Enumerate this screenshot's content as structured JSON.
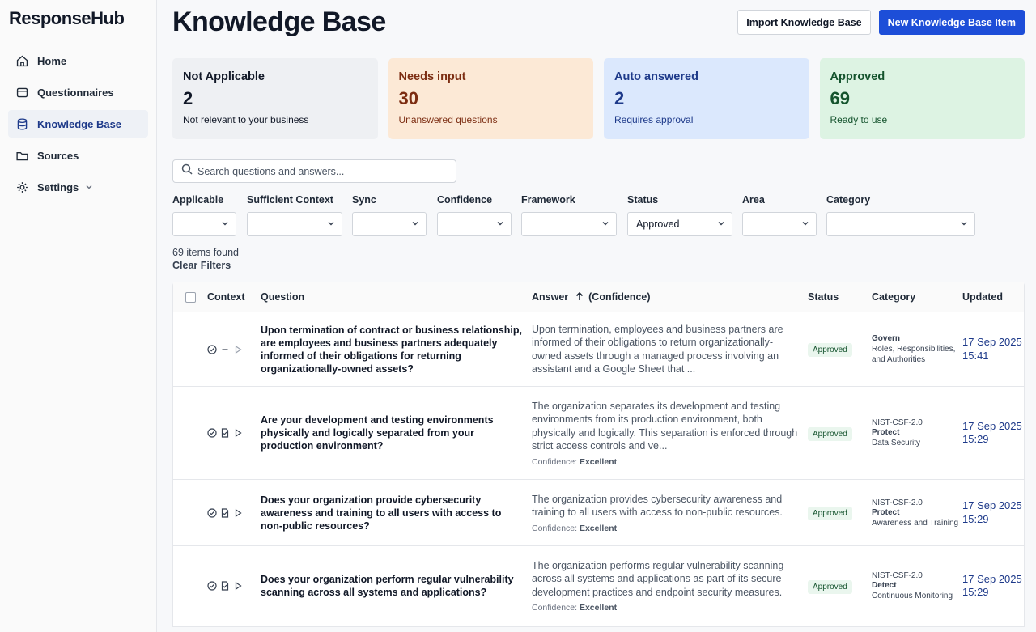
{
  "brand": {
    "logo_text": "ResponseHub"
  },
  "sidebar": {
    "items": [
      {
        "label": "Home",
        "icon": "home-icon"
      },
      {
        "label": "Questionnaires",
        "icon": "document-icon"
      },
      {
        "label": "Knowledge Base",
        "icon": "stack-icon",
        "active": true
      },
      {
        "label": "Sources",
        "icon": "folder-icon"
      },
      {
        "label": "Settings",
        "icon": "gear-icon"
      }
    ]
  },
  "header": {
    "title": "Knowledge Base",
    "import_label": "Import Knowledge Base",
    "new_label": "New Knowledge Base Item"
  },
  "stats": [
    {
      "label": "Not Applicable",
      "value": "2",
      "desc": "Not relevant to your business"
    },
    {
      "label": "Needs input",
      "value": "30",
      "desc": "Unanswered questions"
    },
    {
      "label": "Auto answered",
      "value": "2",
      "desc": "Requires approval"
    },
    {
      "label": "Approved",
      "value": "69",
      "desc": "Ready to use"
    }
  ],
  "search": {
    "placeholder": "Search questions and answers..."
  },
  "filters": [
    {
      "label": "Applicable",
      "value": ""
    },
    {
      "label": "Sufficient Context",
      "value": ""
    },
    {
      "label": "Sync",
      "value": ""
    },
    {
      "label": "Confidence",
      "value": ""
    },
    {
      "label": "Framework",
      "value": ""
    },
    {
      "label": "Status",
      "value": "Approved"
    },
    {
      "label": "Area",
      "value": ""
    },
    {
      "label": "Category",
      "value": ""
    }
  ],
  "results": {
    "count_text": "69 items found",
    "clear_label": "Clear Filters"
  },
  "table": {
    "headers": {
      "context": "Context",
      "question": "Question",
      "answer": "Answer",
      "confidence": "(Confidence)",
      "status": "Status",
      "category": "Category",
      "updated": "Updated"
    },
    "rows": [
      {
        "question": "Upon termination of contract or business relationship, are employees and business partners adequately informed of their obligations for returning organizationally-owned assets?",
        "answer": "Upon termination, employees and business partners are informed of their obligations to return organizationally-owned assets through a managed process involving an assistant and a Google Sheet that ...",
        "confidence_prefix": "",
        "confidence": "",
        "status": "Approved",
        "cat_framework": "Govern",
        "cat_function": "",
        "cat_area": "Roles, Responsibilities, and Authorities",
        "updated_date": "17 Sep 2025",
        "updated_time": "15:41",
        "ctx_doc": false
      },
      {
        "question": "Are your development and testing environments physically and logically separated from your production environment?",
        "answer": "The organization separates its development and testing environments from its production environment, both physically and logically. This separation is enforced through strict access controls and ve...",
        "confidence_prefix": "Confidence:",
        "confidence": "Excellent",
        "status": "Approved",
        "cat_framework": "NIST-CSF-2.0",
        "cat_function": "Protect",
        "cat_area": "Data Security",
        "updated_date": "17 Sep 2025",
        "updated_time": "15:29",
        "ctx_doc": true
      },
      {
        "question": "Does your organization provide cybersecurity awareness and training to all users with access to non-public resources?",
        "answer": "The organization provides cybersecurity awareness and training to all users with access to non-public resources.",
        "confidence_prefix": "Confidence:",
        "confidence": "Excellent",
        "status": "Approved",
        "cat_framework": "NIST-CSF-2.0",
        "cat_function": "Protect",
        "cat_area": "Awareness and Training",
        "updated_date": "17 Sep 2025",
        "updated_time": "15:29",
        "ctx_doc": true
      },
      {
        "question": "Does your organization perform regular vulnerability scanning across all systems and applications?",
        "answer": "The organization performs regular vulnerability scanning across all systems and applications as part of its secure development practices and endpoint security measures.",
        "confidence_prefix": "Confidence:",
        "confidence": "Excellent",
        "status": "Approved",
        "cat_framework": "NIST-CSF-2.0",
        "cat_function": "Detect",
        "cat_area": "Continuous Monitoring",
        "updated_date": "17 Sep 2025",
        "updated_time": "15:29",
        "ctx_doc": true
      }
    ]
  }
}
